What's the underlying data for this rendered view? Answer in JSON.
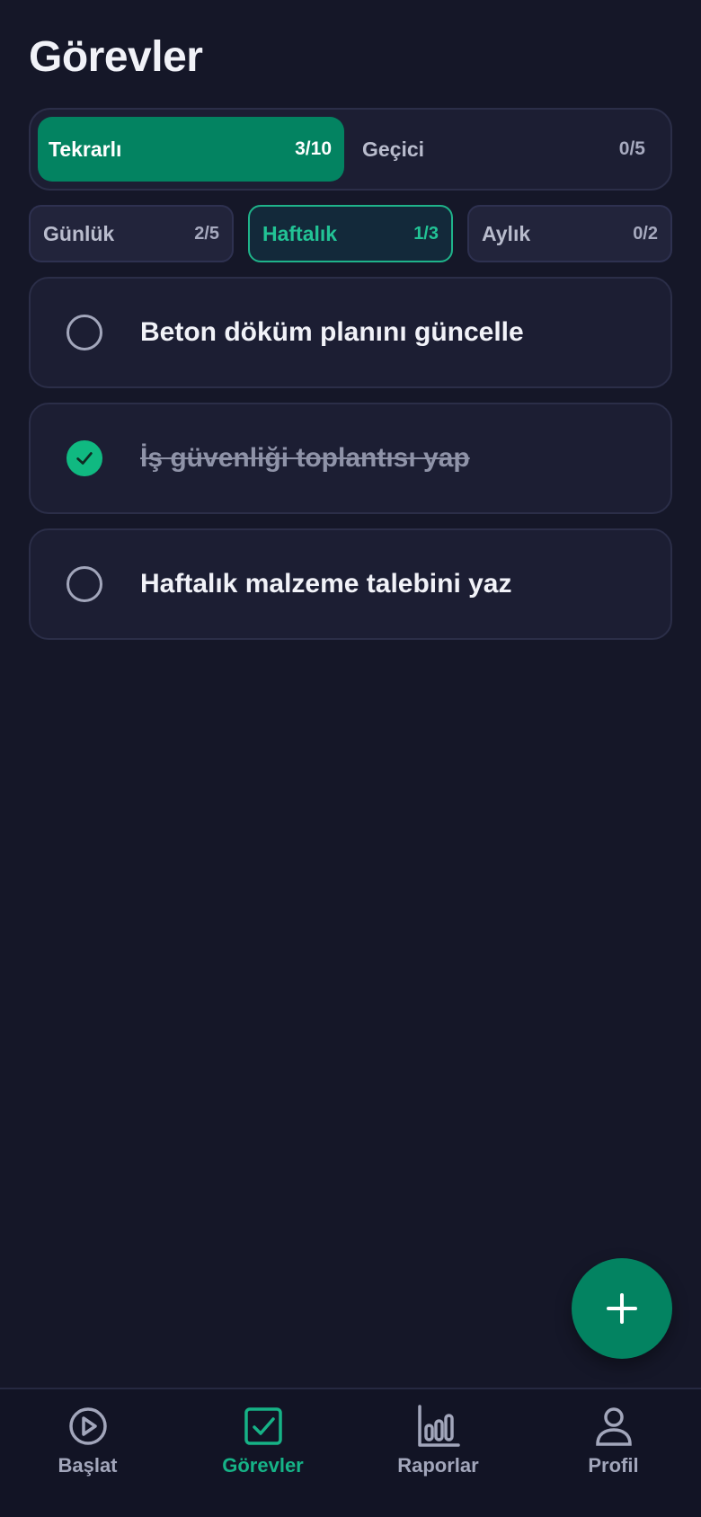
{
  "header": {
    "title": "Görevler"
  },
  "segments": [
    {
      "label": "Tekrarlı",
      "count": "3/10",
      "active": true
    },
    {
      "label": "Geçici",
      "count": "0/5",
      "active": false
    }
  ],
  "periods": [
    {
      "label": "Günlük",
      "count": "2/5",
      "active": false
    },
    {
      "label": "Haftalık",
      "count": "1/3",
      "active": true
    },
    {
      "label": "Aylık",
      "count": "0/2",
      "active": false
    }
  ],
  "tasks": [
    {
      "text": "Beton döküm planını güncelle",
      "done": false
    },
    {
      "text": "İş güvenliği toplantısı yap",
      "done": true
    },
    {
      "text": "Haftalık malzeme talebini yaz",
      "done": false
    }
  ],
  "fab": {
    "icon": "plus-icon"
  },
  "bottom_nav": [
    {
      "label": "Başlat",
      "icon": "play-circle-icon",
      "active": false
    },
    {
      "label": "Görevler",
      "icon": "checkbox-icon",
      "active": true
    },
    {
      "label": "Raporlar",
      "icon": "bar-chart-icon",
      "active": false
    },
    {
      "label": "Profil",
      "icon": "user-icon",
      "active": false
    }
  ],
  "colors": {
    "background": "#151728",
    "accent": "#038361",
    "accent_bright": "#10b981",
    "card": "#1c1e33"
  }
}
